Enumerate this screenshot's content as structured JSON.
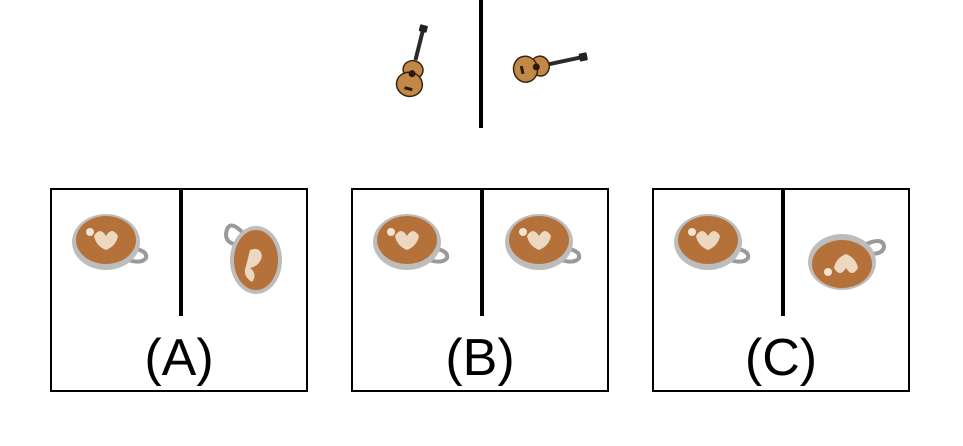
{
  "options": [
    {
      "label": "(A)"
    },
    {
      "label": "(B)"
    },
    {
      "label": "(C)"
    }
  ],
  "icons": {
    "reference": "guitar-icon",
    "option": "latte-cup-icon"
  },
  "colors": {
    "line": "#000000",
    "coffee": "#b5713a",
    "cup": "#9a9a9a",
    "guitar": "#c18848"
  }
}
